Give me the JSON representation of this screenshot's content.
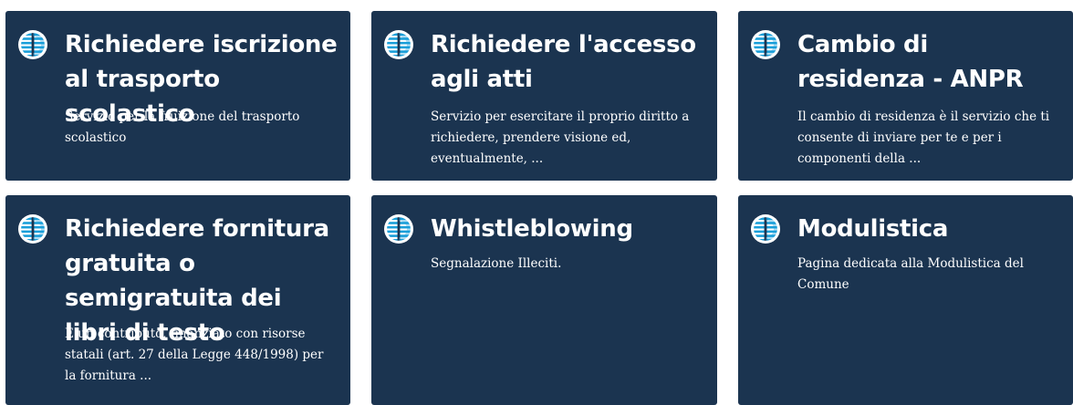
{
  "colors": {
    "card_background": "#1b3450",
    "card_text": "#ffffff",
    "icon_accent": "#1a9fd9"
  },
  "cards": [
    {
      "icon": "service-globe-icon",
      "title": "Richiedere iscrizione al trasporto scolastico",
      "description": "Servizio per la fruizione del trasporto scolastico"
    },
    {
      "icon": "service-globe-icon",
      "title": "Richiedere l'accesso agli atti",
      "description": "Servizio per esercitare il proprio diritto a richiedere, prendere visione ed, eventualmente, ..."
    },
    {
      "icon": "service-globe-icon",
      "title": "Cambio di residenza - ANPR",
      "description": "Il cambio di residenza è il servizio che ti consente di inviare per te e per i componenti della ..."
    },
    {
      "icon": "service-globe-icon",
      "title": "Richiedere fornitura gratuita o semigratuita dei libri di testo",
      "description": "È un contributo, finanziato con risorse statali (art. 27 della Legge 448/1998) per la fornitura ..."
    },
    {
      "icon": "service-globe-icon",
      "title": "Whistleblowing",
      "description": "Segnalazione Illeciti."
    },
    {
      "icon": "service-globe-icon",
      "title": "Modulistica",
      "description": "Pagina dedicata alla Modulistica del Comune"
    }
  ]
}
